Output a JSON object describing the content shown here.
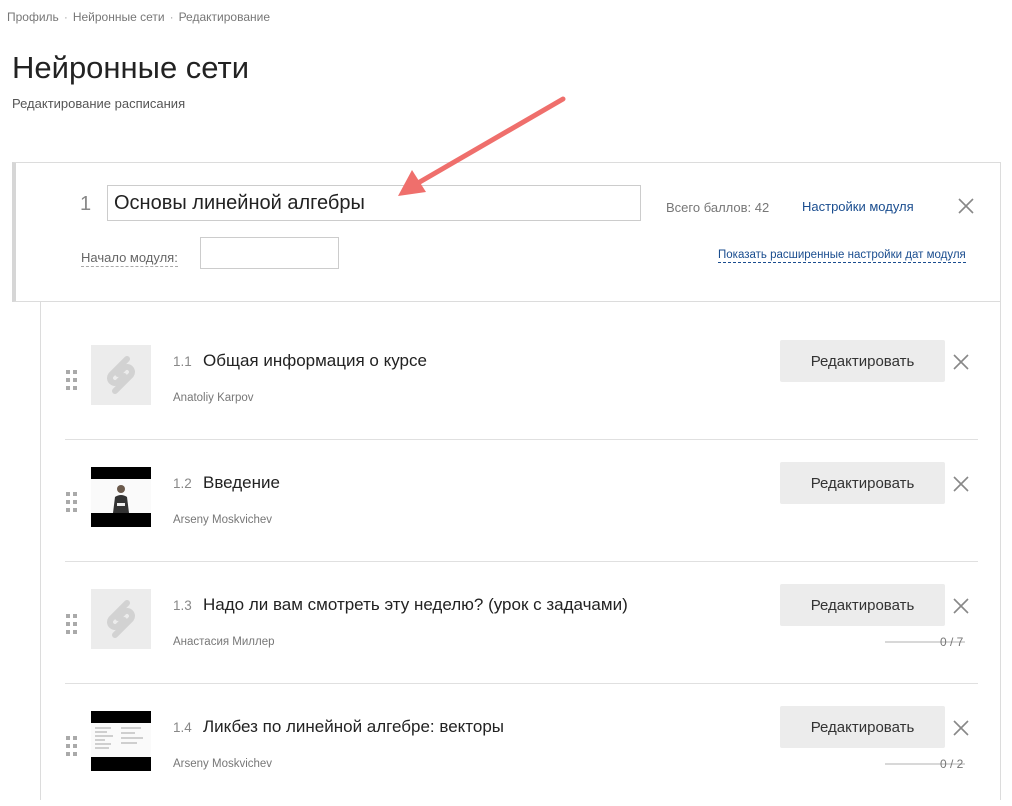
{
  "breadcrumb": [
    "Профиль",
    "Нейронные сети",
    "Редактирование"
  ],
  "page": {
    "title": "Нейронные сети",
    "subtitle": "Редактирование расписания"
  },
  "module": {
    "number": "1",
    "title": "Основы линейной алгебры",
    "total_points": "Всего баллов: 42",
    "settings_link": "Настройки модуля",
    "start_label": "Начало модуля:",
    "start_value": "",
    "advanced_link": "Показать расширенные настройки дат модуля"
  },
  "lessons": [
    {
      "number": "1.1",
      "title": "Общая информация о курсе",
      "author": "Anatoliy Karpov",
      "thumb": "placeholder-logo-icon",
      "edit_label": "Редактировать",
      "progress": ""
    },
    {
      "number": "1.2",
      "title": "Введение",
      "author": "Arseny Moskvichev",
      "thumb": "video-person",
      "edit_label": "Редактировать",
      "progress": ""
    },
    {
      "number": "1.3",
      "title": "Надо ли вам смотреть эту неделю? (урок с задачами)",
      "author": "Анастасия Миллер",
      "thumb": "placeholder-logo-icon",
      "edit_label": "Редактировать",
      "progress": "0 / 7",
      "progress_value": 0
    },
    {
      "number": "1.4",
      "title": "Ликбез по линейной алгебре: векторы",
      "author": "Arseny Moskvichev",
      "thumb": "video-board",
      "edit_label": "Редактировать",
      "progress": "0 / 2",
      "progress_value": 0
    }
  ],
  "colors": {
    "link": "#1a4d8f",
    "arrow": "#ef6f6c",
    "button_bg": "#ececec"
  }
}
